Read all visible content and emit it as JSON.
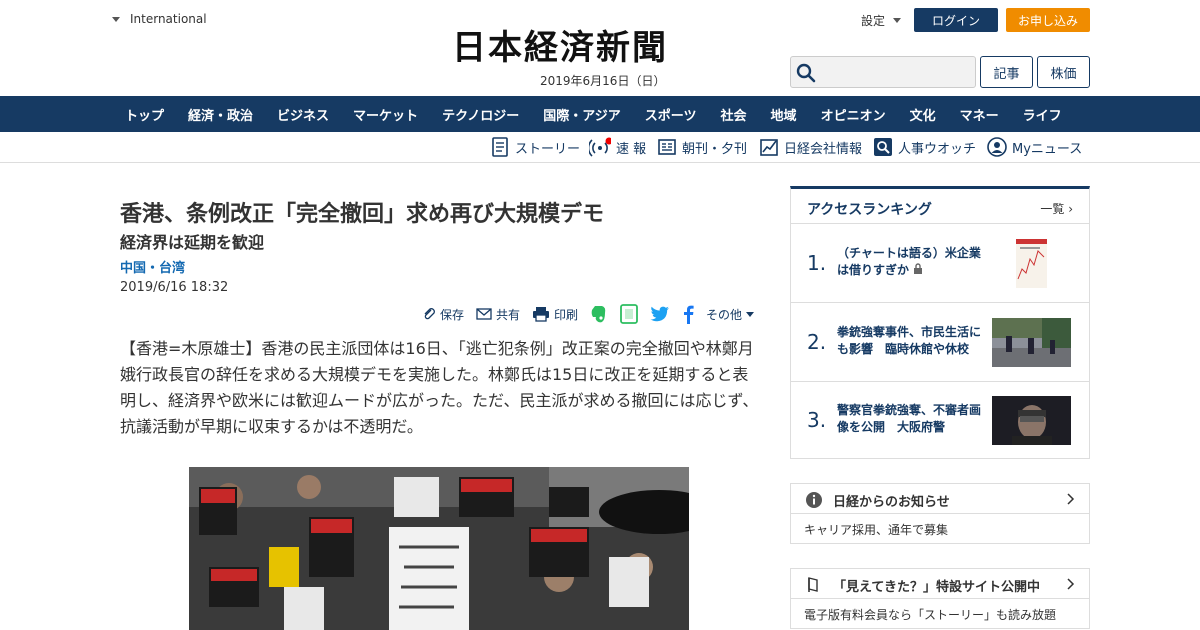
{
  "header": {
    "edition": "International",
    "logo": "日本経済新聞",
    "date": "2019年6月16日（日）",
    "settings": "設定",
    "login": "ログイン",
    "signup": "お申し込み",
    "search_placeholder": "",
    "tab_articles": "記事",
    "tab_stocks": "株価"
  },
  "nav": [
    "トップ",
    "経済・政治",
    "ビジネス",
    "マーケット",
    "テクノロジー",
    "国際・アジア",
    "スポーツ",
    "社会",
    "地域",
    "オピニオン",
    "文化",
    "マネー",
    "ライフ"
  ],
  "subnav": {
    "story": "ストーリー",
    "breaking": "速 報",
    "morning_evening": "朝刊・夕刊",
    "company_info": "日経会社情報",
    "people_watch": "人事ウオッチ",
    "my_news": "Myニュース"
  },
  "article": {
    "headline": "香港、条例改正「完全撤回」求め再び大規模デモ",
    "subhead": "経済界は延期を歓迎",
    "category": "中国・台湾",
    "timestamp": "2019/6/16 18:32",
    "toolbar": {
      "save": "保存",
      "share": "共有",
      "print": "印刷",
      "more": "その他"
    },
    "body": "【香港=木原雄士】香港の民主派団体は16日、「逃亡犯条例」改正案の完全撤回や林鄭月娥行政長官の辞任を求める大規模デモを実施した。林鄭氏は15日に改正を延期すると表明し、経済界や欧米には歓迎ムードが広がった。ただ、民主派が求める撤回には応じず、抗議活動が早期に収束するかは不透明だ。"
  },
  "ranking": {
    "title": "アクセスランキング",
    "more": "一覧",
    "items": [
      {
        "rank": "1.",
        "text": "（チャートは語る）米企業は借りすぎか"
      },
      {
        "rank": "2.",
        "text": "拳銃強奪事件、市民生活にも影響　臨時休館や休校"
      },
      {
        "rank": "3.",
        "text": "警察官拳銃強奪、不審者画像を公開　大阪府警"
      }
    ]
  },
  "notices": [
    {
      "title": "日経からのお知らせ",
      "body": "キャリア採用、通年で募集",
      "icon": "info-icon"
    },
    {
      "title": "「見えてきた？」特設サイト公開中",
      "body": "電子版有料会員なら「ストーリー」も読み放題",
      "icon": "flag-icon"
    }
  ],
  "colors": {
    "brand_navy": "#163a63",
    "accent_orange": "#f08c00",
    "link_blue": "#1469b1"
  }
}
